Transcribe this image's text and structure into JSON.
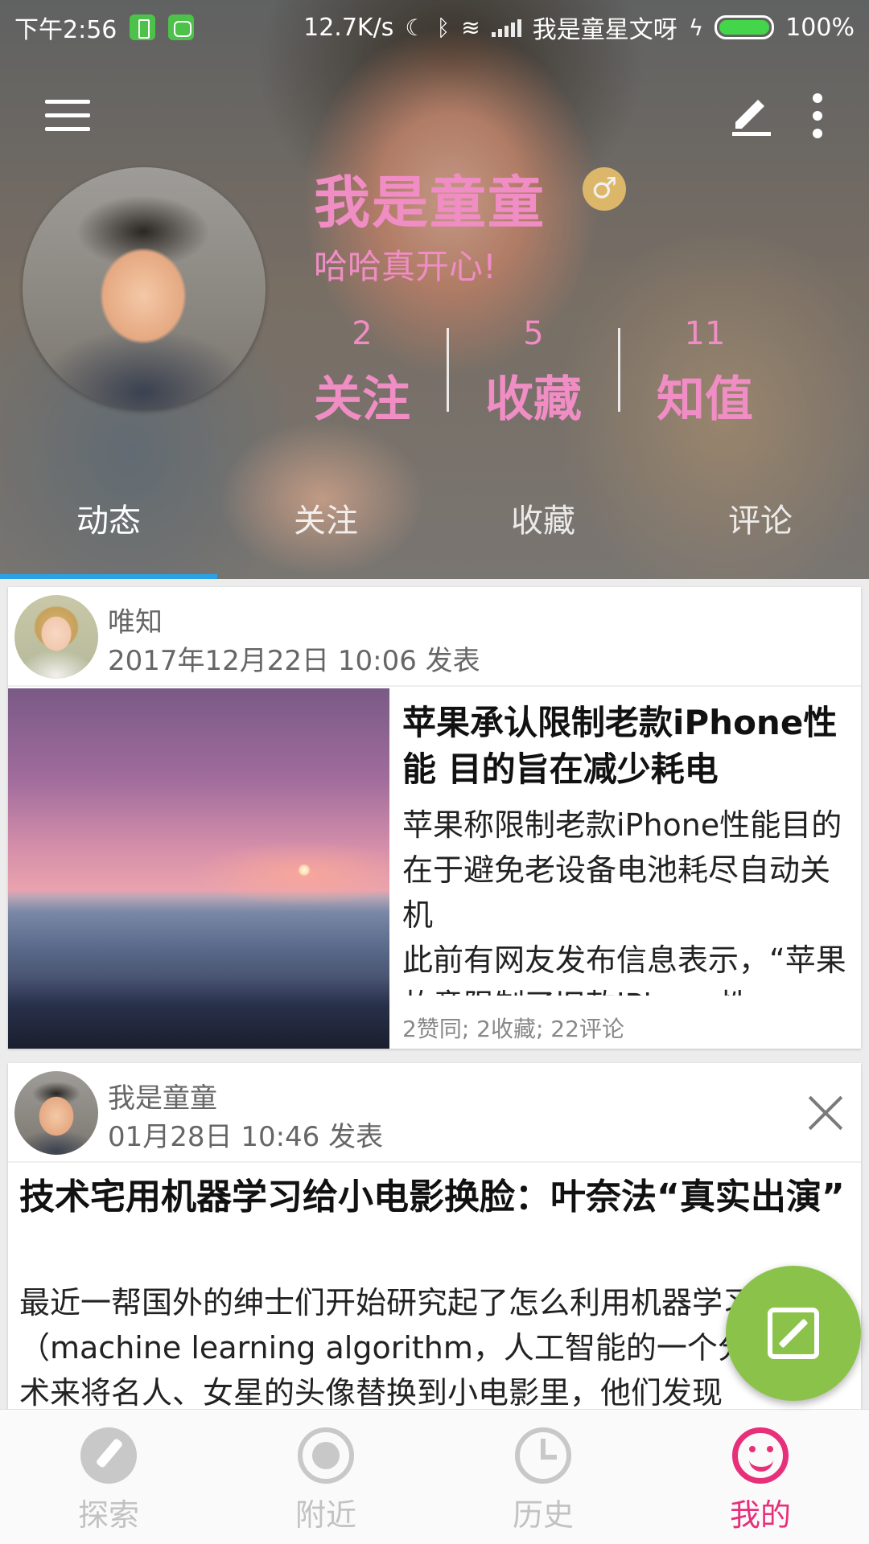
{
  "status_bar": {
    "time": "下午2:56",
    "net_speed": "12.7K/s",
    "carrier": "我是童星文呀",
    "battery": "100%"
  },
  "profile": {
    "name": "我是童童",
    "gender_symbol": "♂",
    "signature": "哈哈真开心!",
    "stats": [
      {
        "count": "2",
        "label": "关注"
      },
      {
        "count": "5",
        "label": "收藏"
      },
      {
        "count": "11",
        "label": "知值"
      }
    ]
  },
  "tabs": [
    "动态",
    "关注",
    "收藏",
    "评论"
  ],
  "feed": [
    {
      "author": "唯知",
      "time": "2017年12月22日 10:06 发表",
      "title": "苹果承认限制老款iPhone性能 目的旨在减少耗电",
      "body": "苹果称限制老款iPhone性能目的在于避免老设备电池耗尽自动关机\n此前有网友发布信息表示，“苹果故意限制了旧款iPhone性",
      "stats": "2赞同; 2收藏; 22评论"
    },
    {
      "author": "我是童童",
      "time": "01月28日 10:46 发表",
      "title": "技术宅用机器学习给小电影换脸：叶奈法“真实出演”",
      "body": "最近一帮国外的绅士们开始研究起了怎么利用机器学习算法（machine learning algorithm，人工智能的一个分支）技术来将名人、女星的头像替换到小电影里，他们发现"
    }
  ],
  "bottom_nav": [
    {
      "label": "探索",
      "icon": "compass-icon"
    },
    {
      "label": "附近",
      "icon": "nearby-icon"
    },
    {
      "label": "历史",
      "icon": "history-icon"
    },
    {
      "label": "我的",
      "icon": "smiley-icon"
    }
  ],
  "colors": {
    "accent_pink": "#f08dc4",
    "nav_active": "#e8307a",
    "fab_green": "#8bc34a",
    "tab_indicator": "#29a3e6"
  }
}
